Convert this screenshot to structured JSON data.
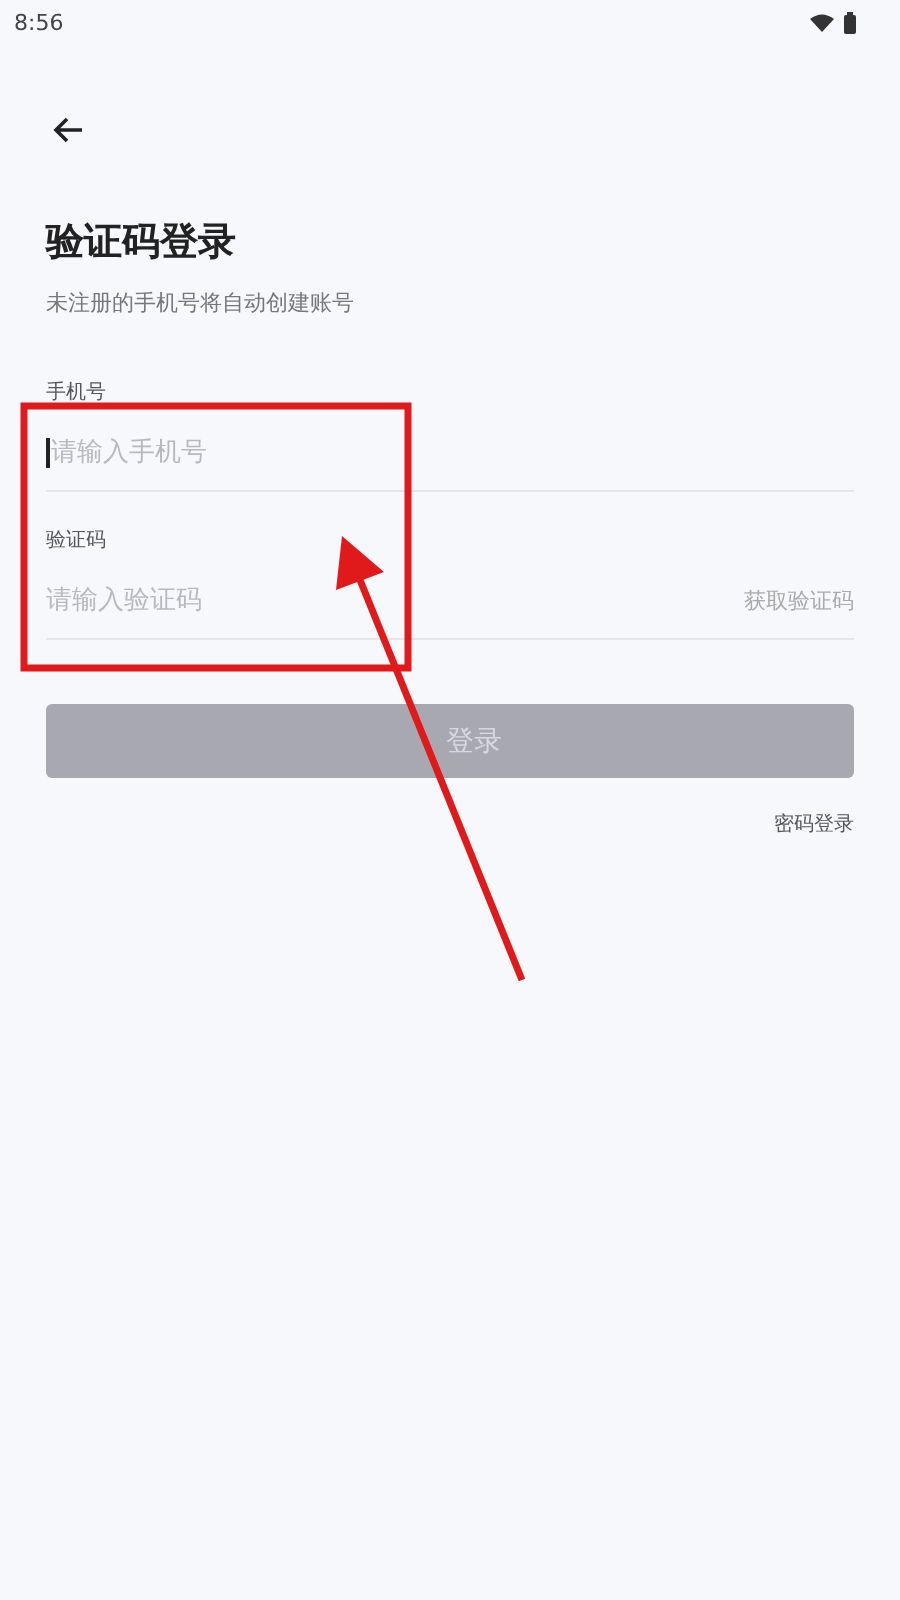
{
  "status_bar": {
    "time": "8:56"
  },
  "title": "验证码登录",
  "subtitle": "未注册的手机号将自动创建账号",
  "fields": [
    {
      "label": "手机号",
      "placeholder": "请输入手机号",
      "focused": true
    },
    {
      "label": "验证码",
      "placeholder": "请输入验证码",
      "focused": false,
      "action": "获取验证码"
    }
  ],
  "login_button": {
    "label": "登录",
    "disabled": true
  },
  "alt_link": "密码登录"
}
